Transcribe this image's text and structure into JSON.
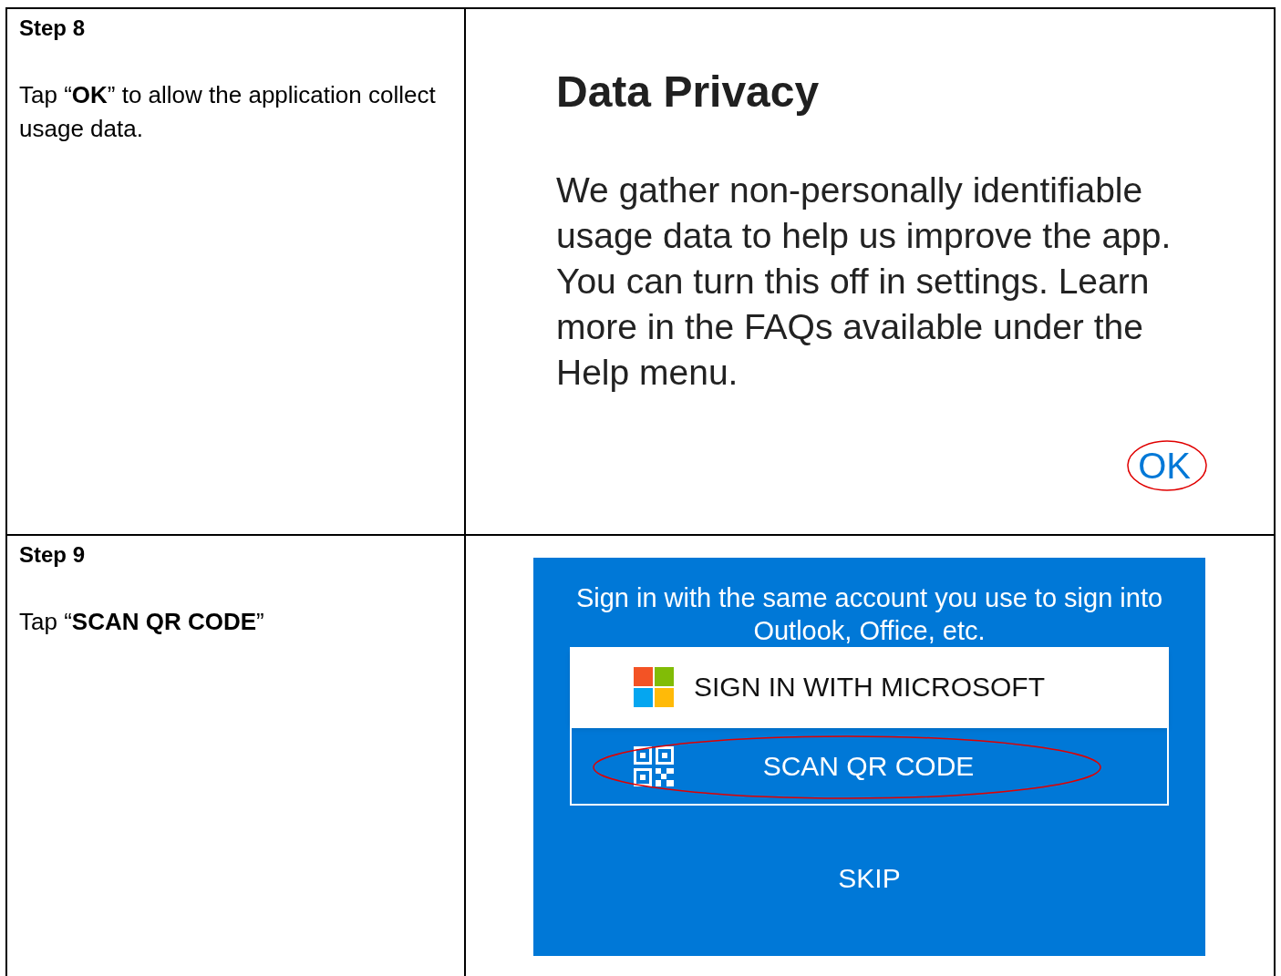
{
  "steps": [
    {
      "heading": "Step 8",
      "instruction": "Tap “**OK**” to allow the application collect usage data.",
      "screen": {
        "kind": "dialog",
        "title": "Data Privacy",
        "body": "We gather non-personally identifiable usage data to help us improve the app. You can turn this off in settings. Learn more in the FAQs available under the Help menu.",
        "button": "OK",
        "circled": true
      }
    },
    {
      "heading": "Step 9",
      "instruction": "Tap “**SCAN QR CODE**”",
      "screen": {
        "kind": "sign_in",
        "message": "Sign in with the same account you use to sign into Outlook, Office, etc.",
        "buttons": [
          {
            "label": "SIGN IN WITH MICROSOFT",
            "kind": "microsoft",
            "circled": false
          },
          {
            "label": "SCAN QR CODE",
            "kind": "qr",
            "circled": true
          }
        ],
        "skip": "SKIP"
      }
    }
  ]
}
